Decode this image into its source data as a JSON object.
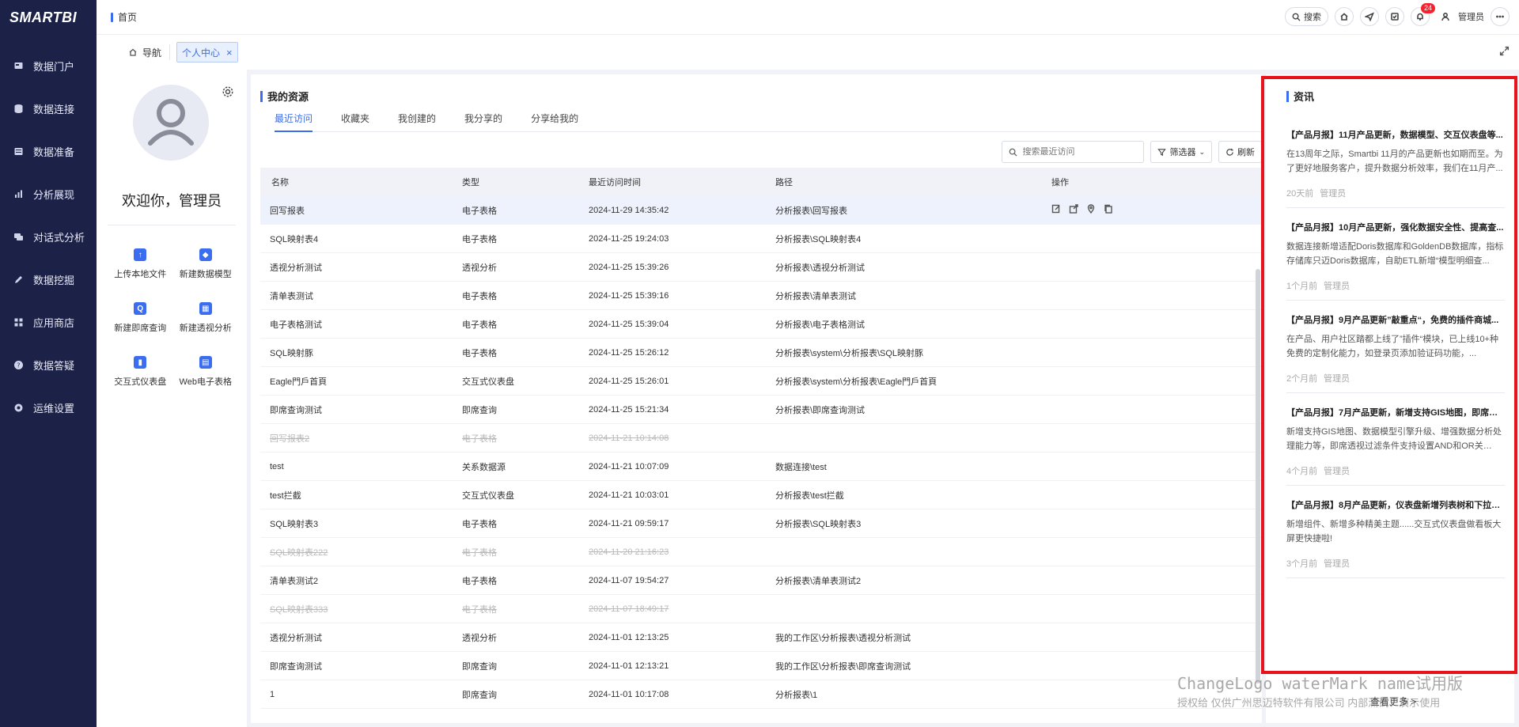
{
  "app": {
    "logo": "SMARTBI",
    "breadcrumb": "首页"
  },
  "sidebar": {
    "items": [
      {
        "label": "数据门户",
        "icon": "portal-icon"
      },
      {
        "label": "数据连接",
        "icon": "database-icon"
      },
      {
        "label": "数据准备",
        "icon": "prepare-icon"
      },
      {
        "label": "分析展现",
        "icon": "bar-chart-icon"
      },
      {
        "label": "对话式分析",
        "icon": "chat-icon"
      },
      {
        "label": "数据挖掘",
        "icon": "pen-icon"
      },
      {
        "label": "应用商店",
        "icon": "grid-icon"
      },
      {
        "label": "数据答疑",
        "icon": "question-icon"
      },
      {
        "label": "运维设置",
        "icon": "gear-icon"
      }
    ]
  },
  "topbar": {
    "search_label": "搜索",
    "notification_count": "24",
    "user_name": "管理员"
  },
  "tabs": {
    "nav_label": "导航",
    "active_label": "个人中心"
  },
  "profile": {
    "welcome": "欢迎你，管理员",
    "actions": [
      {
        "label": "上传本地文件",
        "icon": "upload-icon",
        "glyph": "↑"
      },
      {
        "label": "新建数据模型",
        "icon": "cube-icon",
        "glyph": "◆"
      },
      {
        "label": "新建即席查询",
        "icon": "query-icon",
        "glyph": "Q"
      },
      {
        "label": "新建透视分析",
        "icon": "pivot-icon",
        "glyph": "▦"
      },
      {
        "label": "交互式仪表盘",
        "icon": "dashboard-icon",
        "glyph": "▮"
      },
      {
        "label": "Web电子表格",
        "icon": "spreadsheet-icon",
        "glyph": "▤"
      }
    ]
  },
  "resources": {
    "title": "我的资源",
    "tabs": [
      "最近访问",
      "收藏夹",
      "我创建的",
      "我分享的",
      "分享给我的"
    ],
    "search_placeholder": "搜索最近访问",
    "filter_label": "筛选器",
    "refresh_label": "刷新",
    "columns": [
      "名称",
      "类型",
      "最近访问时间",
      "路径",
      "操作"
    ],
    "rows": [
      {
        "name": "回写报表",
        "type": "电子表格",
        "time": "2024-11-29 14:35:42",
        "path": "分析报表\\回写报表",
        "deleted": false,
        "ops": true
      },
      {
        "name": "SQL映射表4",
        "type": "电子表格",
        "time": "2024-11-25 19:24:03",
        "path": "分析报表\\SQL映射表4",
        "deleted": false
      },
      {
        "name": "透视分析测试",
        "type": "透视分析",
        "time": "2024-11-25 15:39:26",
        "path": "分析报表\\透视分析测试",
        "deleted": false
      },
      {
        "name": "清单表测试",
        "type": "电子表格",
        "time": "2024-11-25 15:39:16",
        "path": "分析报表\\清单表测试",
        "deleted": false
      },
      {
        "name": "电子表格测试",
        "type": "电子表格",
        "time": "2024-11-25 15:39:04",
        "path": "分析报表\\电子表格测试",
        "deleted": false
      },
      {
        "name": "SQL映射豚",
        "type": "电子表格",
        "time": "2024-11-25 15:26:12",
        "path": "分析报表\\system\\分析报表\\SQL映射豚",
        "deleted": false
      },
      {
        "name": "Eagle門戶首頁",
        "type": "交互式仪表盘",
        "time": "2024-11-25 15:26:01",
        "path": "分析报表\\system\\分析报表\\Eagle門戶首頁",
        "deleted": false
      },
      {
        "name": "即席查询测试",
        "type": "即席查询",
        "time": "2024-11-25 15:21:34",
        "path": "分析报表\\即席查询测试",
        "deleted": false
      },
      {
        "name": "回写报表2",
        "type": "电子表格",
        "time": "2024-11-21 10:14:08",
        "path": "",
        "deleted": true
      },
      {
        "name": "test",
        "type": "关系数据源",
        "time": "2024-11-21 10:07:09",
        "path": "数据连接\\test",
        "deleted": false
      },
      {
        "name": "test拦截",
        "type": "交互式仪表盘",
        "time": "2024-11-21 10:03:01",
        "path": "分析报表\\test拦截",
        "deleted": false
      },
      {
        "name": "SQL映射表3",
        "type": "电子表格",
        "time": "2024-11-21 09:59:17",
        "path": "分析报表\\SQL映射表3",
        "deleted": false
      },
      {
        "name": "SQL映射表222",
        "type": "电子表格",
        "time": "2024-11-20 21:16:23",
        "path": "",
        "deleted": true
      },
      {
        "name": "清单表测试2",
        "type": "电子表格",
        "time": "2024-11-07 19:54:27",
        "path": "分析报表\\清单表测试2",
        "deleted": false
      },
      {
        "name": "SQL映射表333",
        "type": "电子表格",
        "time": "2024-11-07 18:49:17",
        "path": "",
        "deleted": true
      },
      {
        "name": "透视分析测试",
        "type": "透视分析",
        "time": "2024-11-01 12:13:25",
        "path": "我的工作区\\分析报表\\透视分析测试",
        "deleted": false
      },
      {
        "name": "即席查询测试",
        "type": "即席查询",
        "time": "2024-11-01 12:13:21",
        "path": "我的工作区\\分析报表\\即席查询测试",
        "deleted": false
      },
      {
        "name": "1",
        "type": "即席查询",
        "time": "2024-11-01 10:17:08",
        "path": "分析报表\\1",
        "deleted": false
      }
    ]
  },
  "news": {
    "title": "资讯",
    "items": [
      {
        "title": "【产品月报】11月产品更新，数据模型、交互仪表盘等...",
        "desc": "在13周年之际，Smartbi 11月的产品更新也如期而至。为了更好地服务客户，提升数据分析效率，我们在11月产...",
        "time": "20天前",
        "author": "管理员"
      },
      {
        "title": "【产品月报】10月产品更新，强化数据安全性、提高查...",
        "desc": "数据连接新增适配Doris数据库和GoldenDB数据库，指标存储库只迈Doris数据库，自助ETL新增“模型明细查...",
        "time": "1个月前",
        "author": "管理员"
      },
      {
        "title": "【产品月报】9月产品更新”敲重点“，免费的插件商城...",
        "desc": "在产品、用户社区踏都上线了”插件“模块，已上线10+种免费的定制化能力，如登录页添加验证码功能，...",
        "time": "2个月前",
        "author": "管理员"
      },
      {
        "title": "【产品月报】7月产品更新，新增支持GIS地图，即席透...",
        "desc": "新增支持GIS地图、数据模型引擎升级、增强数据分析处理能力等，即席透视过滤条件支持设置AND和OR关系......",
        "time": "4个月前",
        "author": "管理员"
      },
      {
        "title": "【产品月报】8月产品更新，仪表盘新增列表树和下拉树...",
        "desc": "新增组件、新增多种精美主题......交互式仪表盘做看板大屏更快捷啦!",
        "time": "3个月前",
        "author": "管理员"
      }
    ],
    "more_label": "查看更多 >"
  },
  "watermark": {
    "line1": "ChangeLogo waterMark name试用版",
    "line2": "授权给 仅供广州思迈特软件有限公司 内部测试、演示使用"
  }
}
